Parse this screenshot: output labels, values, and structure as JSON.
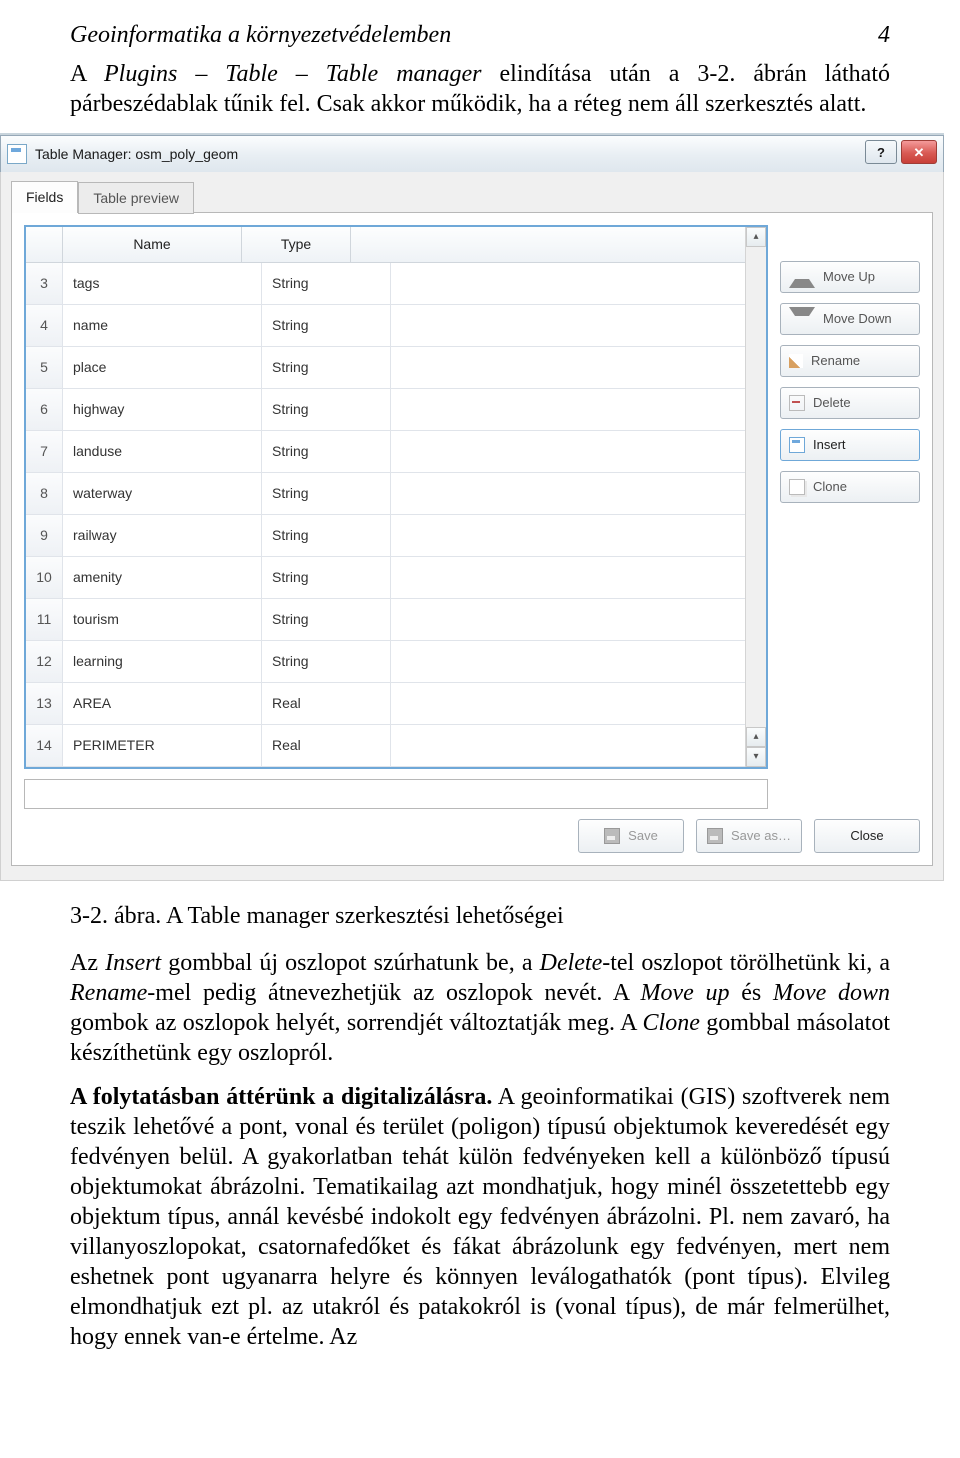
{
  "header": {
    "title": "Geoinformatika a környezetvédelemben",
    "page": "4"
  },
  "intro": {
    "t1": "A ",
    "tit": "Plugins – Table – Table manager",
    "t2": " elindítása után a 3-2. ábrán látható párbeszédablak tűnik fel. Csak akkor működik, ha a réteg nem áll szerkesztés alatt."
  },
  "window_title": "Table Manager: osm_poly_geom",
  "help": "?",
  "close": "✕",
  "tabs": {
    "a": "Fields",
    "b": "Table preview"
  },
  "cols": {
    "name": "Name",
    "type": "Type"
  },
  "rows": [
    {
      "n": "3",
      "name": "tags",
      "type": "String"
    },
    {
      "n": "4",
      "name": "name",
      "type": "String"
    },
    {
      "n": "5",
      "name": "place",
      "type": "String"
    },
    {
      "n": "6",
      "name": "highway",
      "type": "String"
    },
    {
      "n": "7",
      "name": "landuse",
      "type": "String"
    },
    {
      "n": "8",
      "name": "waterway",
      "type": "String"
    },
    {
      "n": "9",
      "name": "railway",
      "type": "String"
    },
    {
      "n": "10",
      "name": "amenity",
      "type": "String"
    },
    {
      "n": "11",
      "name": "tourism",
      "type": "String"
    },
    {
      "n": "12",
      "name": "learning",
      "type": "String"
    },
    {
      "n": "13",
      "name": "AREA",
      "type": "Real"
    },
    {
      "n": "14",
      "name": "PERIMETER",
      "type": "Real"
    }
  ],
  "buttons": {
    "moveup": "Move Up",
    "movedown": "Move Down",
    "rename": "Rename",
    "delete": "Delete",
    "insert": "Insert",
    "clone": "Clone",
    "save": "Save",
    "saveas": "Save as…",
    "closebtn": "Close"
  },
  "caption": "3-2. ábra. A Table manager szerkesztési lehetőségei",
  "p2": {
    "a": "Az ",
    "insert": "Insert",
    "b": " gombbal új oszlopot szúrhatunk be, a ",
    "delete": "Delete",
    "c": "-tel oszlopot törölhetünk ki, a ",
    "rename": "Rename",
    "d": "-mel pedig átnevezhetjük az oszlopok nevét. A ",
    "mu": "Move up",
    "e": " és ",
    "md": "Move down",
    "f": " gombok az oszlopok helyét, sorrendjét változtatják meg. A ",
    "clone": "Clone",
    "g": " gombbal másolatot készíthetünk egy oszlopról."
  },
  "p3": {
    "lead": "A folytatásban áttérünk a digitalizálásra.",
    "rest": " A geoinformatikai (GIS) szoftverek nem teszik lehetővé a pont, vonal és terület (poligon) típusú objektumok keveredését egy fedvényen belül. A gyakorlatban tehát külön fedvényeken kell a különböző típusú objektumokat ábrázolni. Tematikailag azt mondhatjuk, hogy minél összetettebb egy objektum típus, annál kevésbé indokolt egy fedvényen ábrázolni. Pl. nem zavaró, ha villanyoszlopokat, csatornafedőket és fákat ábrázolunk egy fedvényen, mert nem eshetnek pont ugyanarra helyre és könnyen leválogathatók (pont típus). Elvileg elmondhatjuk ezt pl. az utakról és patakokról is (vonal típus), de már felmerülhet, hogy ennek van-e értelme. Az"
  }
}
